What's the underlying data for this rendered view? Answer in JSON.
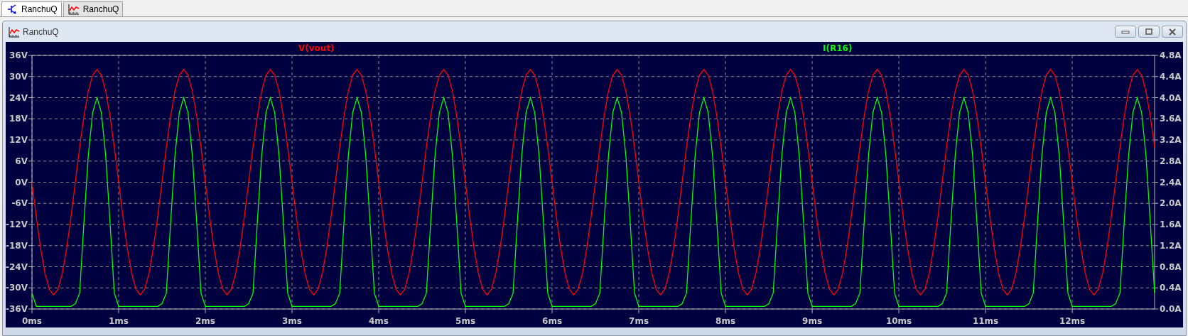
{
  "tabs": [
    {
      "label": "RanchuQ",
      "kind": "schematic",
      "selected": true
    },
    {
      "label": "RanchuQ",
      "kind": "waveform",
      "selected": false
    }
  ],
  "window": {
    "title": "RanchuQ"
  },
  "plot": {
    "chart_data": {
      "type": "line",
      "grid": true,
      "xlim": [
        0,
        12.95
      ],
      "ylim": [
        -36,
        36
      ],
      "xticks": [
        {
          "value": 0,
          "label": "0ms"
        },
        {
          "value": 1,
          "label": "1ms"
        },
        {
          "value": 2,
          "label": "2ms"
        },
        {
          "value": 3,
          "label": "3ms"
        },
        {
          "value": 4,
          "label": "4ms"
        },
        {
          "value": 5,
          "label": "5ms"
        },
        {
          "value": 6,
          "label": "6ms"
        },
        {
          "value": 7,
          "label": "7ms"
        },
        {
          "value": 8,
          "label": "8ms"
        },
        {
          "value": 9,
          "label": "9ms"
        },
        {
          "value": 10,
          "label": "10ms"
        },
        {
          "value": 11,
          "label": "11ms"
        },
        {
          "value": 12,
          "label": "12ms"
        }
      ],
      "yticks": [
        {
          "value": 36,
          "label": "36V"
        },
        {
          "value": 30,
          "label": "30V"
        },
        {
          "value": 24,
          "label": "24V"
        },
        {
          "value": 18,
          "label": "18V"
        },
        {
          "value": 12,
          "label": "12V"
        },
        {
          "value": 6,
          "label": "6V"
        },
        {
          "value": 0,
          "label": "0V"
        },
        {
          "value": -6,
          "label": "-6V"
        },
        {
          "value": -12,
          "label": "-12V"
        },
        {
          "value": -18,
          "label": "-18V"
        },
        {
          "value": -24,
          "label": "-24V"
        },
        {
          "value": -30,
          "label": "-30V"
        },
        {
          "value": -36,
          "label": "-36V"
        }
      ],
      "y2lim": [
        0,
        4.8
      ],
      "y2ticks": [
        {
          "value": 4.8,
          "label": "4.8A"
        },
        {
          "value": 4.4,
          "label": "4.4A"
        },
        {
          "value": 4,
          "label": "4.0A"
        },
        {
          "value": 3.6,
          "label": "3.6A"
        },
        {
          "value": 3.2,
          "label": "3.2A"
        },
        {
          "value": 2.8,
          "label": "2.8A"
        },
        {
          "value": 2.4,
          "label": "2.4A"
        },
        {
          "value": 2,
          "label": "2.0A"
        },
        {
          "value": 1.6,
          "label": "1.6A"
        },
        {
          "value": 1.2,
          "label": "1.2A"
        },
        {
          "value": 0.8,
          "label": "0.8A"
        },
        {
          "value": 0.4,
          "label": "0.4A"
        },
        {
          "value": 0,
          "label": "0.0A"
        }
      ],
      "x": [
        0,
        0.05,
        0.1,
        0.15,
        0.2,
        0.25,
        0.3,
        0.35,
        0.4,
        0.45,
        0.5,
        0.55,
        0.6,
        0.65,
        0.7,
        0.75,
        0.8,
        0.85,
        0.9,
        0.95,
        1,
        1.05,
        1.1,
        1.15,
        1.2,
        1.25,
        1.3,
        1.35,
        1.4,
        1.45,
        1.5,
        1.55,
        1.6,
        1.65,
        1.7,
        1.75,
        1.8,
        1.85,
        1.9,
        1.95,
        2,
        2.05,
        2.1,
        2.15,
        2.2,
        2.25,
        2.3,
        2.35,
        2.4,
        2.45,
        2.5,
        2.55,
        2.6,
        2.65,
        2.7,
        2.75,
        2.8,
        2.85,
        2.9,
        2.95,
        3,
        3.05,
        3.1,
        3.15,
        3.2,
        3.25,
        3.3,
        3.35,
        3.4,
        3.45,
        3.5,
        3.55,
        3.6,
        3.65,
        3.7,
        3.75,
        3.8,
        3.85,
        3.9,
        3.95,
        4,
        4.05,
        4.1,
        4.15,
        4.2,
        4.25,
        4.3,
        4.35,
        4.4,
        4.45,
        4.5,
        4.55,
        4.6,
        4.65,
        4.7,
        4.75,
        4.8,
        4.85,
        4.9,
        4.95,
        5,
        5.05,
        5.1,
        5.15,
        5.2,
        5.25,
        5.3,
        5.35,
        5.4,
        5.45,
        5.5,
        5.55,
        5.6,
        5.65,
        5.7,
        5.75,
        5.8,
        5.85,
        5.9,
        5.95,
        6,
        6.05,
        6.1,
        6.15,
        6.2,
        6.25,
        6.3,
        6.35,
        6.4,
        6.45,
        6.5,
        6.55,
        6.6,
        6.65,
        6.7,
        6.75,
        6.8,
        6.85,
        6.9,
        6.95,
        7,
        7.05,
        7.1,
        7.15,
        7.2,
        7.25,
        7.3,
        7.35,
        7.4,
        7.45,
        7.5,
        7.55,
        7.6,
        7.65,
        7.7,
        7.75,
        7.8,
        7.85,
        7.9,
        7.95,
        8,
        8.05,
        8.1,
        8.15,
        8.2,
        8.25,
        8.3,
        8.35,
        8.4,
        8.45,
        8.5,
        8.55,
        8.6,
        8.65,
        8.7,
        8.75,
        8.8,
        8.85,
        8.9,
        8.95,
        9,
        9.05,
        9.1,
        9.15,
        9.2,
        9.25,
        9.3,
        9.35,
        9.4,
        9.45,
        9.5,
        9.55,
        9.6,
        9.65,
        9.7,
        9.75,
        9.8,
        9.85,
        9.9,
        9.95,
        10,
        10.05,
        10.1,
        10.15,
        10.2,
        10.25,
        10.3,
        10.35,
        10.4,
        10.45,
        10.5,
        10.55,
        10.6,
        10.65,
        10.7,
        10.75,
        10.8,
        10.85,
        10.9,
        10.95,
        11,
        11.05,
        11.1,
        11.15,
        11.2,
        11.25,
        11.3,
        11.35,
        11.4,
        11.45,
        11.5,
        11.55,
        11.6,
        11.65,
        11.7,
        11.75,
        11.8,
        11.85,
        11.9,
        11.95,
        12,
        12.05,
        12.1,
        12.15,
        12.2,
        12.25,
        12.3,
        12.35,
        12.4,
        12.45,
        12.5,
        12.55,
        12.6,
        12.65,
        12.7,
        12.75,
        12.8,
        12.85,
        12.9,
        12.95
      ],
      "series": [
        {
          "name": "V(vout)",
          "color": "#ff0000",
          "values": [
            0,
            -9.9,
            -18.8,
            -25.9,
            -30.4,
            -32,
            -30.4,
            -25.9,
            -18.8,
            -9.9,
            0,
            9.9,
            18.8,
            25.9,
            30.4,
            32,
            30.4,
            25.9,
            18.8,
            9.9,
            0,
            -9.9,
            -18.8,
            -25.9,
            -30.4,
            -32,
            -30.4,
            -25.9,
            -18.8,
            -9.9,
            0,
            9.9,
            18.8,
            25.9,
            30.4,
            32,
            30.4,
            25.9,
            18.8,
            9.9,
            0,
            -9.9,
            -18.8,
            -25.9,
            -30.4,
            -32,
            -30.4,
            -25.9,
            -18.8,
            -9.9,
            0,
            9.9,
            18.8,
            25.9,
            30.4,
            32,
            30.4,
            25.9,
            18.8,
            9.9,
            0,
            -9.9,
            -18.8,
            -25.9,
            -30.4,
            -32,
            -30.4,
            -25.9,
            -18.8,
            -9.9,
            0,
            9.9,
            18.8,
            25.9,
            30.4,
            32,
            30.4,
            25.9,
            18.8,
            9.9,
            0,
            -9.9,
            -18.8,
            -25.9,
            -30.4,
            -32,
            -30.4,
            -25.9,
            -18.8,
            -9.9,
            0,
            9.9,
            18.8,
            25.9,
            30.4,
            32,
            30.4,
            25.9,
            18.8,
            9.9,
            0,
            -9.9,
            -18.8,
            -25.9,
            -30.4,
            -32,
            -30.4,
            -25.9,
            -18.8,
            -9.9,
            0,
            9.9,
            18.8,
            25.9,
            30.4,
            32,
            30.4,
            25.9,
            18.8,
            9.9,
            0,
            -9.9,
            -18.8,
            -25.9,
            -30.4,
            -32,
            -30.4,
            -25.9,
            -18.8,
            -9.9,
            0,
            9.9,
            18.8,
            25.9,
            30.4,
            32,
            30.4,
            25.9,
            18.8,
            9.9,
            0,
            -9.9,
            -18.8,
            -25.9,
            -30.4,
            -32,
            -30.4,
            -25.9,
            -18.8,
            -9.9,
            0,
            9.9,
            18.8,
            25.9,
            30.4,
            32,
            30.4,
            25.9,
            18.8,
            9.9,
            0,
            -9.9,
            -18.8,
            -25.9,
            -30.4,
            -32,
            -30.4,
            -25.9,
            -18.8,
            -9.9,
            0,
            9.9,
            18.8,
            25.9,
            30.4,
            32,
            30.4,
            25.9,
            18.8,
            9.9,
            0,
            -9.9,
            -18.8,
            -25.9,
            -30.4,
            -32,
            -30.4,
            -25.9,
            -18.8,
            -9.9,
            0,
            9.9,
            18.8,
            25.9,
            30.4,
            32,
            30.4,
            25.9,
            18.8,
            9.9,
            0,
            -9.9,
            -18.8,
            -25.9,
            -30.4,
            -32,
            -30.4,
            -25.9,
            -18.8,
            -9.9,
            0,
            9.9,
            18.8,
            25.9,
            30.4,
            32,
            30.4,
            25.9,
            18.8,
            9.9,
            0,
            -9.9,
            -18.8,
            -25.9,
            -30.4,
            -32,
            -30.4,
            -25.9,
            -18.8,
            -9.9,
            0,
            9.9,
            18.8,
            25.9,
            30.4,
            32,
            30.4,
            25.9,
            18.8,
            9.9,
            0,
            -9.9,
            -18.8,
            -25.9,
            -30.4,
            -32,
            -30.4,
            -25.9,
            -18.8,
            -9.9,
            0,
            9.9,
            18.8,
            25.9,
            30.4,
            32,
            30.4,
            25.9,
            18.8,
            9.9
          ]
        },
        {
          "name": "I(R16)",
          "color": "#00ff00",
          "axis": "y2",
          "values": [
            0.3,
            0.05,
            0.05,
            0.05,
            0.05,
            0.05,
            0.05,
            0.05,
            0.05,
            0.05,
            0.1,
            0.3,
            1.65,
            2.91,
            3.72,
            4,
            3.72,
            2.91,
            1.65,
            0.3,
            0.05,
            0.05,
            0.05,
            0.05,
            0.05,
            0.05,
            0.05,
            0.05,
            0.05,
            0.05,
            0.1,
            0.3,
            1.65,
            2.91,
            3.72,
            4,
            3.72,
            2.91,
            1.65,
            0.3,
            0.05,
            0.05,
            0.05,
            0.05,
            0.05,
            0.05,
            0.05,
            0.05,
            0.05,
            0.05,
            0.1,
            0.3,
            1.65,
            2.91,
            3.72,
            4,
            3.72,
            2.91,
            1.65,
            0.3,
            0.05,
            0.05,
            0.05,
            0.05,
            0.05,
            0.05,
            0.05,
            0.05,
            0.05,
            0.05,
            0.1,
            0.3,
            1.65,
            2.91,
            3.72,
            4,
            3.72,
            2.91,
            1.65,
            0.3,
            0.05,
            0.05,
            0.05,
            0.05,
            0.05,
            0.05,
            0.05,
            0.05,
            0.05,
            0.05,
            0.1,
            0.3,
            1.65,
            2.91,
            3.72,
            4,
            3.72,
            2.91,
            1.65,
            0.3,
            0.05,
            0.05,
            0.05,
            0.05,
            0.05,
            0.05,
            0.05,
            0.05,
            0.05,
            0.05,
            0.1,
            0.3,
            1.65,
            2.91,
            3.72,
            4,
            3.72,
            2.91,
            1.65,
            0.3,
            0.05,
            0.05,
            0.05,
            0.05,
            0.05,
            0.05,
            0.05,
            0.05,
            0.05,
            0.05,
            0.1,
            0.3,
            1.65,
            2.91,
            3.72,
            4,
            3.72,
            2.91,
            1.65,
            0.3,
            0.05,
            0.05,
            0.05,
            0.05,
            0.05,
            0.05,
            0.05,
            0.05,
            0.05,
            0.05,
            0.1,
            0.3,
            1.65,
            2.91,
            3.72,
            4,
            3.72,
            2.91,
            1.65,
            0.3,
            0.05,
            0.05,
            0.05,
            0.05,
            0.05,
            0.05,
            0.05,
            0.05,
            0.05,
            0.05,
            0.1,
            0.3,
            1.65,
            2.91,
            3.72,
            4,
            3.72,
            2.91,
            1.65,
            0.3,
            0.05,
            0.05,
            0.05,
            0.05,
            0.05,
            0.05,
            0.05,
            0.05,
            0.05,
            0.05,
            0.1,
            0.3,
            1.65,
            2.91,
            3.72,
            4,
            3.72,
            2.91,
            1.65,
            0.3,
            0.05,
            0.05,
            0.05,
            0.05,
            0.05,
            0.05,
            0.05,
            0.05,
            0.05,
            0.05,
            0.1,
            0.3,
            1.65,
            2.91,
            3.72,
            4,
            3.72,
            2.91,
            1.65,
            0.3,
            0.05,
            0.05,
            0.05,
            0.05,
            0.05,
            0.05,
            0.05,
            0.05,
            0.05,
            0.05,
            0.1,
            0.3,
            1.65,
            2.91,
            3.72,
            4,
            3.72,
            2.91,
            1.65,
            0.3,
            0.05,
            0.05,
            0.05,
            0.05,
            0.05,
            0.05,
            0.05,
            0.05,
            0.05,
            0.05,
            0.1,
            0.3,
            1.65,
            2.91,
            3.72,
            4,
            3.72,
            2.91,
            1.65,
            0.3
          ]
        }
      ]
    }
  }
}
